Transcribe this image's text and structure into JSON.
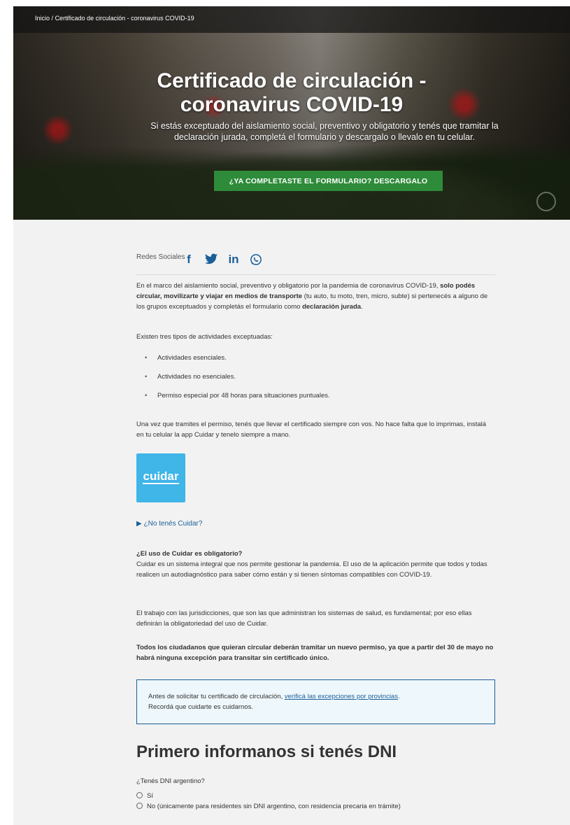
{
  "breadcrumb": {
    "home": "Inicio",
    "separator": "/",
    "current": "Certificado de circulación - coronavirus COVID-19"
  },
  "hero": {
    "title_line1": "Certificado de circulación -",
    "title_line2": "coronavirus COVID-19",
    "subtitle": "Si estás exceptuado del aislamiento social, preventivo y obligatorio y tenés que tramitar la declaración jurada, completá el formulario y descargalo o llevalo en tu celular.",
    "button_label": "¿YA COMPLETASTE EL FORMULARIO? DESCARGALO"
  },
  "social": {
    "label": "Redes Sociales",
    "icons": [
      "facebook-icon",
      "twitter-icon",
      "linkedin-icon",
      "whatsapp-icon"
    ]
  },
  "intro": {
    "part1": "En el marco del aislamiento social, preventivo y obligatorio por la pandemia de coronavirus COVID-19,",
    "bold1": "solo podés circular, movilizarte y viajar en medios de transporte",
    "part2": "(tu auto, tu moto, tren, micro, subte) si pertenecés a alguno de los grupos exceptuados y completás el formulario como",
    "bold2": "declaración jurada",
    "part3": "."
  },
  "types_intro": "Existen tres tipos de actividades exceptuadas:",
  "activities": [
    "Actividades esenciales.",
    "Actividades no esenciales.",
    "Permiso especial por 48 horas para situaciones puntuales."
  ],
  "certificate_note": "Una vez que tramites el permiso, tenés que llevar el certificado siempre con vos. No hace falta que lo imprimas, instalá en tu celular la app Cuidar y tenelo siempre a mano.",
  "cuidar_logo": "cuidar",
  "no_cuidar_toggle": "¿No tenés Cuidar?",
  "faq": {
    "question": "¿El uso de Cuidar es obligatorio?",
    "answer1": "Cuidar es un sistema integral que nos permite gestionar la pandemia. El uso de la aplicación permite que todos y todas realicen un autodiagnóstico para saber cómo están y si tienen síntomas compatibles con COVID-19.",
    "answer2": "El trabajo con las jurisdicciones, que son las que administran los sistemas de salud, es fundamental; por eso ellas definirán la obligatoriedad del uso de Cuidar.",
    "answer3": "Todos los ciudadanos que quieran circular deberán tramitar un nuevo permiso, ya que a partir del 30 de mayo no habrá ninguna excepción para transitar sin certificado único."
  },
  "alert": {
    "text_before": "Antes de solicitar tu certificado de circulación,",
    "link": "verificá las excepciones por provincias",
    "text_after": ".",
    "line2": "Recordá que cuidarte es cuidarnos."
  },
  "dni": {
    "heading": "Primero informanos si tenés DNI",
    "question": "¿Tenés DNI argentino?",
    "option_yes": "Sí",
    "option_no": "No (únicamente para residentes sin DNI argentino, con residencia precaria en trámite)"
  },
  "colors": {
    "accent": "#1a5f99",
    "button_green": "#2e8b3a",
    "cuidar_blue": "#3fb5e8",
    "alert_bg": "#eef7fb"
  }
}
